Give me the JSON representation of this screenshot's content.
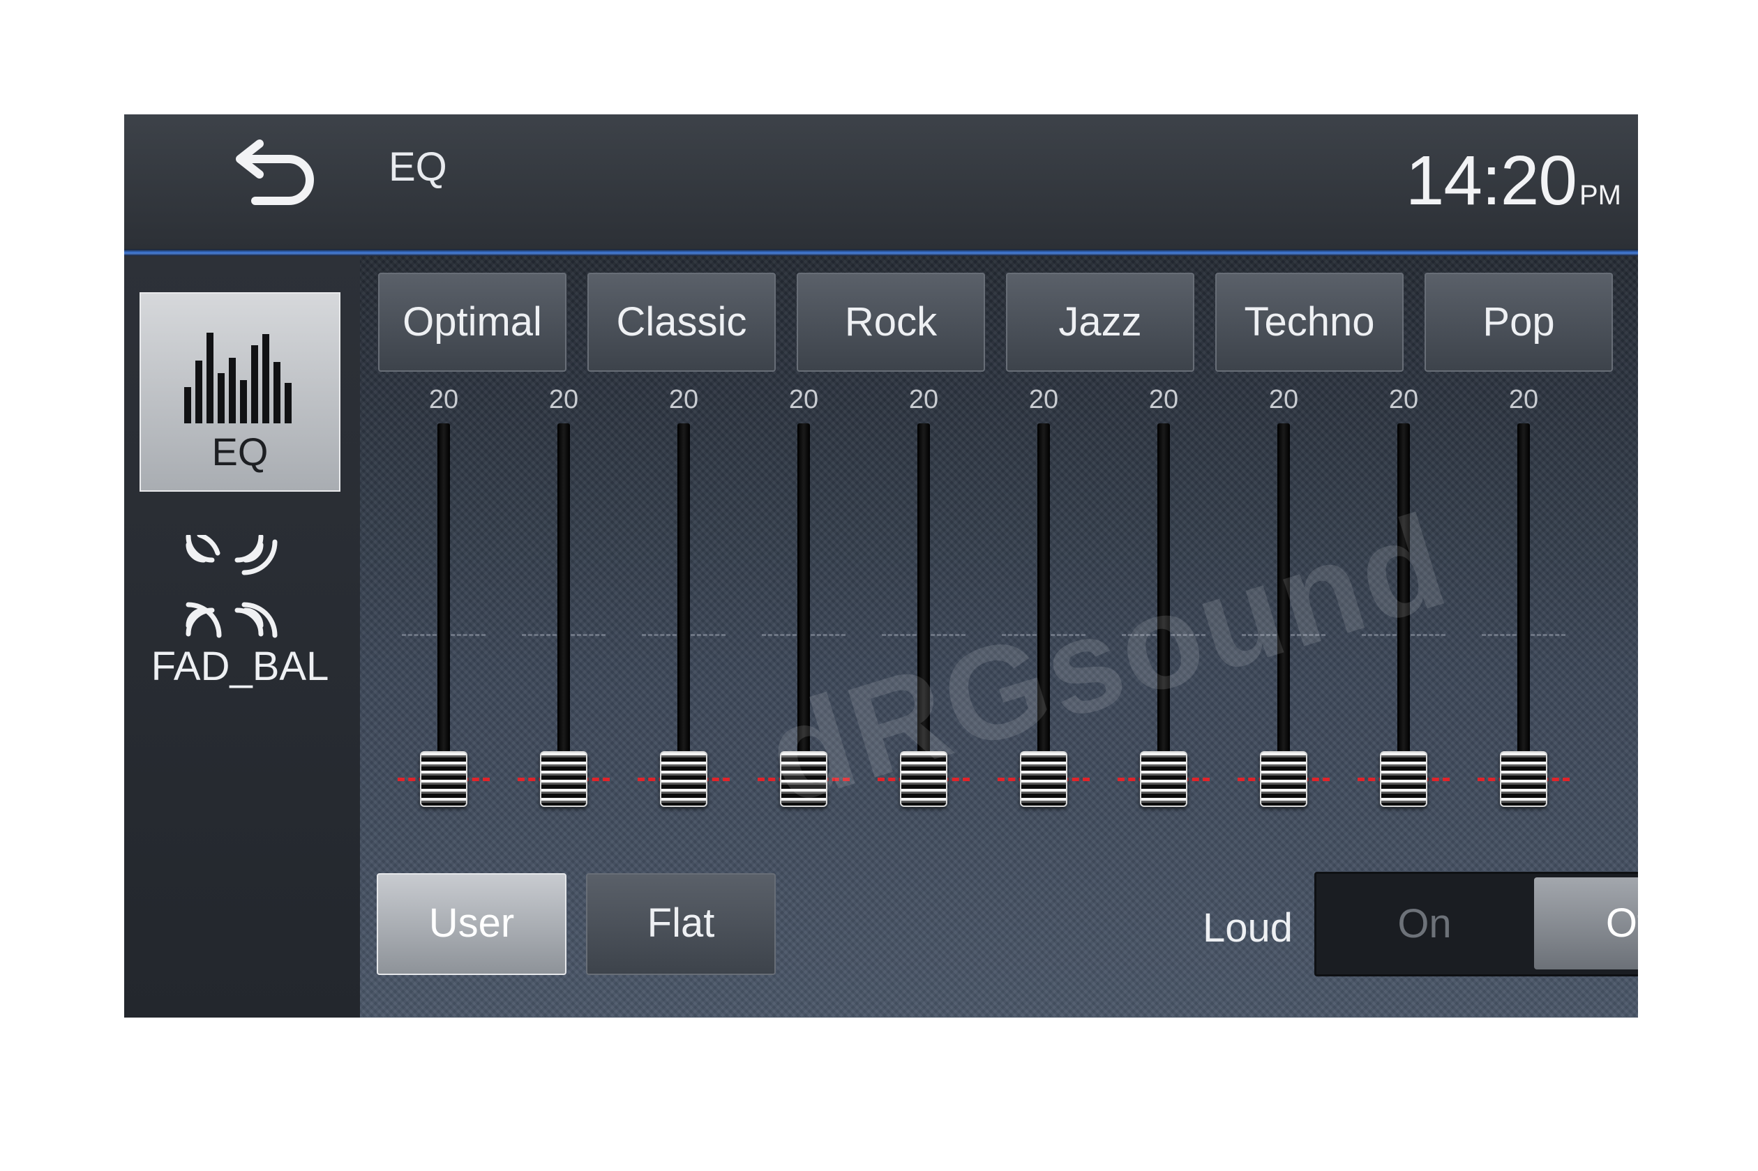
{
  "header": {
    "title": "EQ",
    "clock_time": "14:20",
    "clock_ampm": "PM"
  },
  "sidebar": {
    "eq_tab": {
      "label": "EQ",
      "selected": true
    },
    "fadbal_tab": {
      "label": "FAD_BAL",
      "selected": false
    }
  },
  "presets": [
    "Optimal",
    "Classic",
    "Rock",
    "Jazz",
    "Techno",
    "Pop"
  ],
  "bands": [
    {
      "value": "20",
      "level": 0
    },
    {
      "value": "20",
      "level": 0
    },
    {
      "value": "20",
      "level": 0
    },
    {
      "value": "20",
      "level": 0
    },
    {
      "value": "20",
      "level": 0
    },
    {
      "value": "20",
      "level": 0
    },
    {
      "value": "20",
      "level": 0
    },
    {
      "value": "20",
      "level": 0
    },
    {
      "value": "20",
      "level": 0
    },
    {
      "value": "20",
      "level": 0
    }
  ],
  "bottom": {
    "user_label": "User",
    "flat_label": "Flat",
    "loud_label": "Loud",
    "loud_on_label": "On",
    "loud_off_label": "Off",
    "loud_state": "Off"
  },
  "watermark": "dRGsound",
  "colors": {
    "accent_line": "#3a74cc",
    "slider_marker": "#e0242a",
    "selected_button": "#b5b9be"
  }
}
